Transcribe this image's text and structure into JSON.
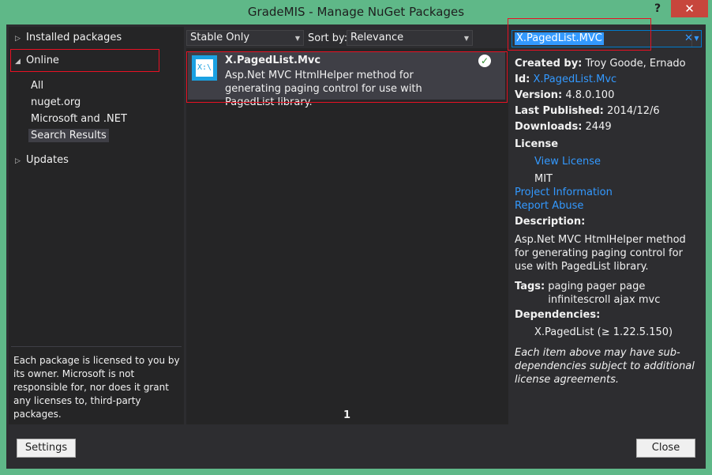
{
  "window": {
    "title": "GradeMIS - Manage NuGet Packages",
    "help": "?",
    "close": "✕"
  },
  "sidebar": {
    "installed": "Installed packages",
    "online": "Online",
    "sub_items": [
      "All",
      "nuget.org",
      "Microsoft and .NET",
      "Search Results"
    ],
    "updates": "Updates",
    "license_note": "Each package is licensed to you by its owner. Microsoft is not responsible for, nor does it grant any licenses to, third-party packages."
  },
  "toolbar": {
    "filter_value": "Stable Only",
    "sort_label": "Sort by:",
    "sort_value": "Relevance",
    "search_value": "X.PagedList.MVC",
    "clear": "✕"
  },
  "results": {
    "items": [
      {
        "name": "X.PagedList.Mvc",
        "description": "Asp.Net MVC HtmlHelper method for generating paging control for use with PagedList library.",
        "icon_text": "X:\\"
      }
    ],
    "page": "1"
  },
  "details": {
    "created_by_label": "Created by:",
    "created_by": "Troy Goode,  Ernado",
    "id_label": "Id:",
    "id": "X.PagedList.Mvc",
    "version_label": "Version:",
    "version": "4.8.0.100",
    "last_published_label": "Last Published:",
    "last_published": "2014/12/6",
    "downloads_label": "Downloads:",
    "downloads": "2449",
    "license_label": "License",
    "view_license": "View License",
    "license_name": "MIT",
    "project_information": "Project Information",
    "report_abuse": "Report Abuse",
    "description_label": "Description:",
    "description": "Asp.Net MVC HtmlHelper method for generating paging control for use with PagedList library.",
    "tags_label": "Tags:",
    "tags": "paging pager page infinitescroll ajax mvc",
    "dependencies_label": "Dependencies:",
    "dependency": "X.PagedList (≥ 1.22.5.150)",
    "sub_dependencies_note": "Each item above may have sub-dependencies subject to additional license agreements."
  },
  "footer": {
    "settings": "Settings",
    "close": "Close"
  },
  "colors": {
    "accent": "#3399ff",
    "title_bg": "#5fb888",
    "highlight": "#e81123"
  }
}
